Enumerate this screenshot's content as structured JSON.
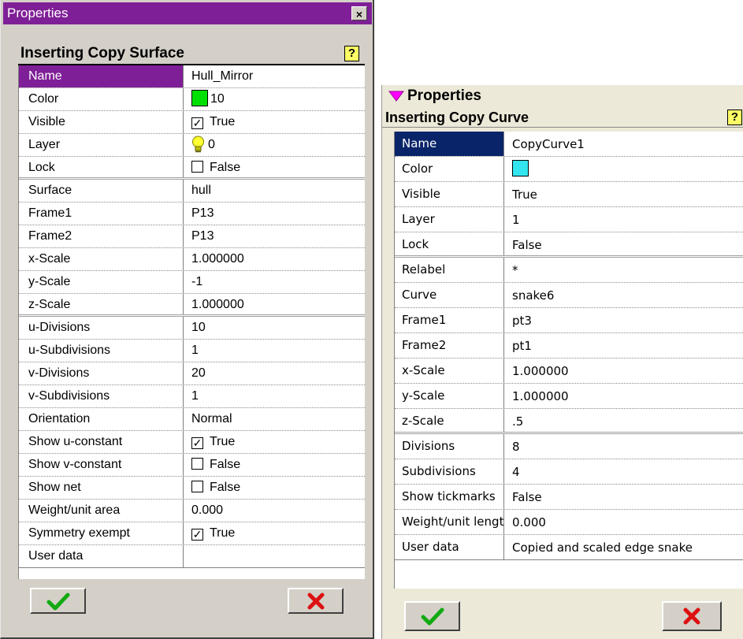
{
  "left_panel": {
    "window_title": "Properties",
    "close_glyph": "×",
    "caption": "Inserting Copy Surface",
    "help_glyph": "?",
    "ok_icon": "green-checkmark",
    "cancel_icon": "red-x",
    "colors": {
      "title_bar": "#7f1f97",
      "selected_row": "#7f1f97",
      "swatch": "#00e000"
    },
    "rows": [
      {
        "key": "Name",
        "value": "Hull_Mirror"
      },
      {
        "key": "Color",
        "value": "10"
      },
      {
        "key": "Visible",
        "value": "True",
        "checked": true
      },
      {
        "key": "Layer",
        "value": "0"
      },
      {
        "key": "Lock",
        "value": "False",
        "checked": false
      },
      {
        "key": "Surface",
        "value": "hull"
      },
      {
        "key": "Frame1",
        "value": "P13"
      },
      {
        "key": "Frame2",
        "value": "P13"
      },
      {
        "key": "x-Scale",
        "value": "1.000000"
      },
      {
        "key": "y-Scale",
        "value": "-1"
      },
      {
        "key": "z-Scale",
        "value": "1.000000"
      },
      {
        "key": "u-Divisions",
        "value": "10"
      },
      {
        "key": "u-Subdivisions",
        "value": "1"
      },
      {
        "key": "v-Divisions",
        "value": "20"
      },
      {
        "key": "v-Subdivisions",
        "value": "1"
      },
      {
        "key": "Orientation",
        "value": "Normal"
      },
      {
        "key": "Show u-constant",
        "value": "True",
        "checked": true
      },
      {
        "key": "Show v-constant",
        "value": "False",
        "checked": false
      },
      {
        "key": "Show net",
        "value": "False",
        "checked": false
      },
      {
        "key": "Weight/unit area",
        "value": "0.000"
      },
      {
        "key": "Symmetry exempt",
        "value": "True",
        "checked": true
      },
      {
        "key": "User data",
        "value": ""
      }
    ]
  },
  "right_panel": {
    "window_title": "Properties",
    "caption": "Inserting Copy Curve",
    "help_glyph": "?",
    "ok_icon": "green-checkmark",
    "cancel_icon": "red-x",
    "colors": {
      "selected_row": "#0a246a",
      "swatch": "#33e5ee",
      "triangle": "#ff00ff"
    },
    "rows": [
      {
        "key": "Name",
        "value": "CopyCurve1"
      },
      {
        "key": "Color",
        "value": ""
      },
      {
        "key": "Visible",
        "value": "True"
      },
      {
        "key": "Layer",
        "value": "1"
      },
      {
        "key": "Lock",
        "value": "False"
      },
      {
        "key": "Relabel",
        "value": "*"
      },
      {
        "key": "Curve",
        "value": "snake6"
      },
      {
        "key": "Frame1",
        "value": "pt3"
      },
      {
        "key": "Frame2",
        "value": "pt1"
      },
      {
        "key": "x-Scale",
        "value": "1.000000"
      },
      {
        "key": "y-Scale",
        "value": "1.000000"
      },
      {
        "key": "z-Scale",
        "value": ".5"
      },
      {
        "key": "Divisions",
        "value": "8"
      },
      {
        "key": "Subdivisions",
        "value": "4"
      },
      {
        "key": "Show tickmarks",
        "value": "False"
      },
      {
        "key": "Weight/unit length",
        "value": "0.000"
      },
      {
        "key": "User data",
        "value": "Copied and scaled edge snake"
      }
    ]
  }
}
